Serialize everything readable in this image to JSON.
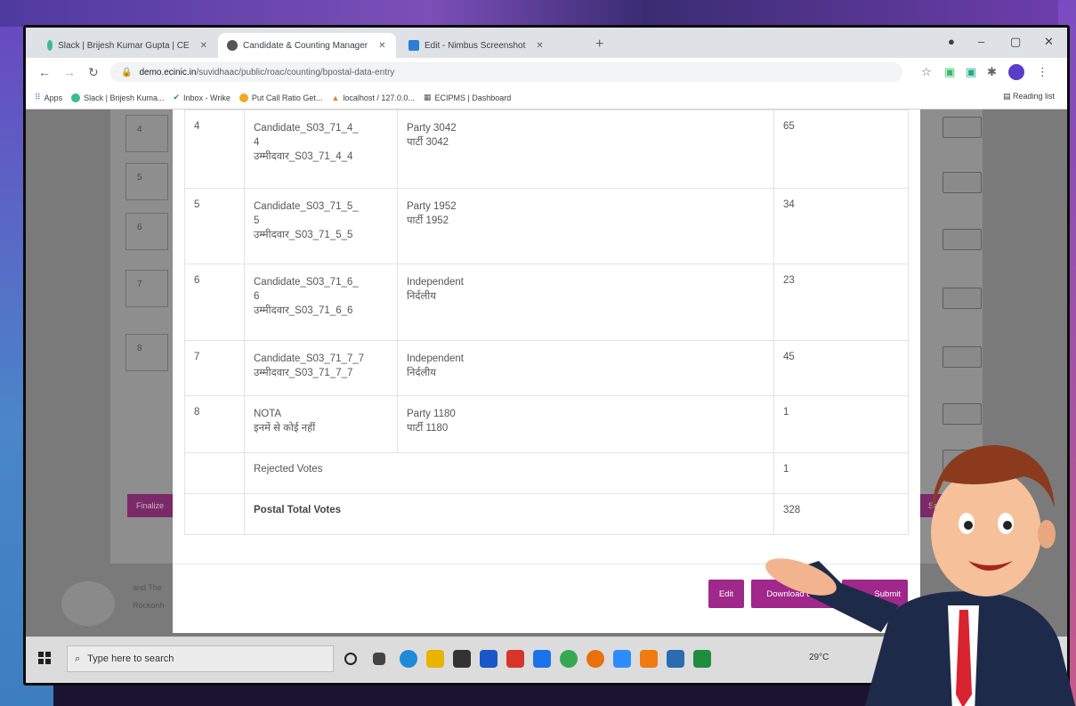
{
  "tabs": [
    {
      "title": "Slack | Brijesh Kumar Gupta | CE"
    },
    {
      "title": "Candidate & Counting Manager"
    },
    {
      "title": "Edit - Nimbus Screenshot"
    }
  ],
  "address": {
    "domain": "demo.ecinic.in",
    "path": "/suvidhaac/public/roac/counting/bpostal-data-entry"
  },
  "bookmarks": {
    "apps": "Apps",
    "items": [
      "Slack | Brijesh Kuma...",
      "Inbox - Wrike",
      "Put Call Ratio Get...",
      "localhost / 127.0.0...",
      "ECIPMS | Dashboard"
    ],
    "reading_list": "Reading list"
  },
  "background": {
    "rows": [
      "4",
      "5",
      "6",
      "7",
      "8"
    ],
    "finalize": "Finalize",
    "save": "Save",
    "footer1": "and The",
    "footer2": "Rockonh"
  },
  "table": {
    "rows": [
      {
        "sno": "4",
        "cand1": "Candidate_S03_71_4_",
        "cand2": "4",
        "cand3": "उम्मीदवार_S03_71_4_4",
        "party1": "Party 3042",
        "party2": "पार्टी 3042",
        "votes": "65"
      },
      {
        "sno": "5",
        "cand1": "Candidate_S03_71_5_",
        "cand2": "5",
        "cand3": "उम्मीदवार_S03_71_5_5",
        "party1": "Party 1952",
        "party2": "पार्टी 1952",
        "votes": "34"
      },
      {
        "sno": "6",
        "cand1": "Candidate_S03_71_6_",
        "cand2": "6",
        "cand3": "उम्मीदवार_S03_71_6_6",
        "party1": "Independent",
        "party2": "निर्दलीय",
        "votes": "23"
      },
      {
        "sno": "7",
        "cand1": "Candidate_S03_71_7_7",
        "cand2": "उम्मीदवार_S03_71_7_7",
        "cand3": "",
        "party1": "Independent",
        "party2": "निर्दलीय",
        "votes": "45"
      },
      {
        "sno": "8",
        "cand1": "NOTA",
        "cand2": "इनमें से कोई नहीं",
        "cand3": "",
        "party1": "Party 1180",
        "party2": "पार्टी 1180",
        "votes": "1"
      }
    ],
    "rejected_label": "Rejected Votes",
    "rejected_votes": "1",
    "total_label": "Postal Total Votes",
    "total_votes": "328"
  },
  "buttons": {
    "edit": "Edit",
    "download": "Download & P",
    "submit": "Submit"
  },
  "taskbar": {
    "search": "Type here to search",
    "weather": "29°C"
  }
}
